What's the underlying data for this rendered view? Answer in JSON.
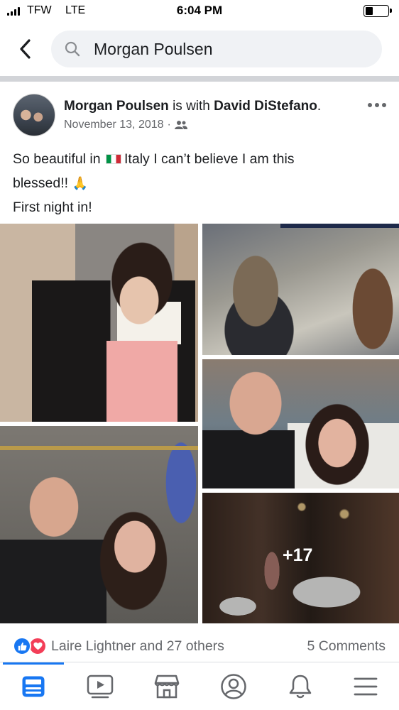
{
  "status_bar": {
    "carrier": "TFW",
    "network": "LTE",
    "time": "6:04 PM",
    "battery_level": 0.32
  },
  "search": {
    "query": "Morgan Poulsen",
    "search_icon": "search-icon",
    "back_icon": "back-chevron-icon"
  },
  "post": {
    "author": "Morgan Poulsen",
    "with_text": "is with",
    "tagged": "David DiStefano",
    "date": "November 13, 2018",
    "separator": "·",
    "audience_icon": "friends-icon",
    "text_line1_a": "So beautiful in",
    "text_line1_b": "Italy I can’t believe I am this",
    "text_line2": "blessed!!",
    "text_line3": "First night in!",
    "flag_emoji": "italy-flag",
    "pray_emoji": "🙏",
    "more_photos": "+17"
  },
  "reactions": {
    "names": "Laire Lightner and 27 others",
    "comments": "5 Comments",
    "types": [
      "like",
      "love"
    ]
  },
  "colors": {
    "accent": "#1877f2",
    "love": "#f33e58",
    "secondary_text": "#65676b"
  },
  "tabs": [
    "news-feed-icon",
    "watch-icon",
    "marketplace-icon",
    "profile-icon",
    "notifications-icon",
    "menu-icon"
  ]
}
